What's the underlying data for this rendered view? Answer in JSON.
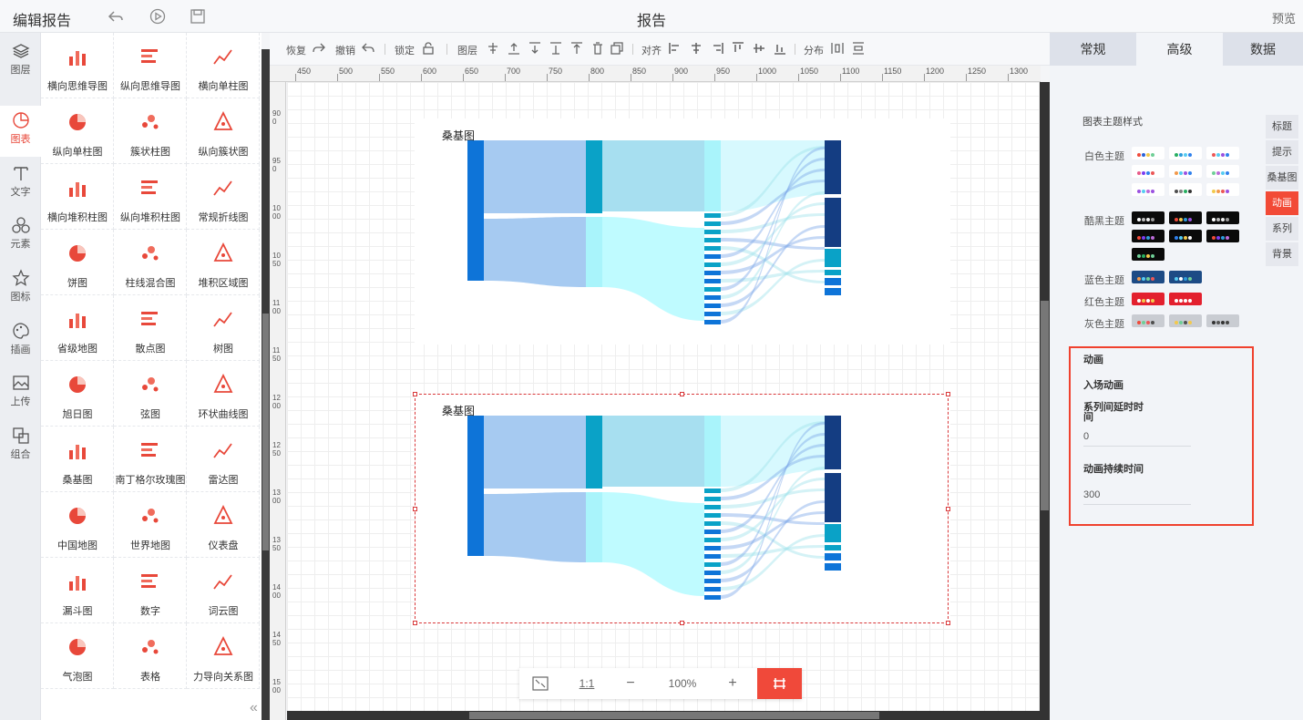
{
  "topbar": {
    "app_title": "编辑报告",
    "doc_title": "报告",
    "preview_label": "预览",
    "icons": [
      "undo-icon",
      "play-icon",
      "save-icon"
    ]
  },
  "leftnav": [
    {
      "label": "图层",
      "icon": "layers-icon"
    },
    {
      "label": "图表",
      "icon": "chart-icon",
      "active": true
    },
    {
      "label": "文字",
      "icon": "text-icon"
    },
    {
      "label": "元素",
      "icon": "shapes-icon"
    },
    {
      "label": "图标",
      "icon": "star-icon"
    },
    {
      "label": "插画",
      "icon": "palette-icon"
    },
    {
      "label": "上传",
      "icon": "upload-image-icon"
    },
    {
      "label": "组合",
      "icon": "group-icon"
    }
  ],
  "palette": [
    "横向思维导图",
    "纵向思维导图",
    "横向单柱图",
    "纵向单柱图",
    "簇状柱图",
    "纵向簇状图",
    "横向堆积柱图",
    "纵向堆积柱图",
    "常规折线图",
    "饼图",
    "柱线混合图",
    "堆积区域图",
    "省级地图",
    "散点图",
    "树图",
    "旭日图",
    "弦图",
    "环状曲线图",
    "桑基图",
    "南丁格尔玫瑰图",
    "雷达图",
    "中国地图",
    "世界地图",
    "仪表盘",
    "漏斗图",
    "数字",
    "词云图",
    "气泡图",
    "表格",
    "力导向关系图"
  ],
  "toolbar": {
    "redo": "恢复",
    "undo": "撤销",
    "lock": "锁定",
    "layer": "图层",
    "align": "对齐",
    "distribute": "分布"
  },
  "ruler": {
    "top": [
      "450",
      "500",
      "550",
      "600",
      "650",
      "700",
      "750",
      "800",
      "850",
      "900",
      "950",
      "1000",
      "1050",
      "1100",
      "1150",
      "1200",
      "1250",
      "1300"
    ],
    "left": [
      "900",
      "950",
      "1000",
      "1050",
      "1100",
      "1150",
      "1200",
      "1250",
      "1300",
      "1350",
      "1400",
      "1450",
      "1500"
    ]
  },
  "canvas": {
    "charts": [
      {
        "title": "桑基图"
      },
      {
        "title": "桑基图"
      }
    ]
  },
  "zoombar": {
    "fit_icon": "fit-screen-icon",
    "ratio": "1:1",
    "minus": "−",
    "zoom": "100%",
    "plus": "+",
    "grid_icon": "grid-icon"
  },
  "rightpanel": {
    "tabs": [
      "常规",
      "高级",
      "数据"
    ],
    "active_tab": "高级",
    "theme_title": "图表主题样式",
    "themes": [
      {
        "label": "白色主题",
        "rows": 3
      },
      {
        "label": "酷黑主题",
        "rows": 3
      },
      {
        "label": "蓝色主题",
        "rows": 1
      },
      {
        "label": "红色主题",
        "rows": 1
      },
      {
        "label": "灰色主题",
        "rows": 1
      }
    ],
    "side_tabs": [
      "标题",
      "提示",
      "桑基图",
      "动画",
      "系列",
      "背景"
    ],
    "active_side_tab": "动画",
    "animation": {
      "title": "动画",
      "enter": "入场动画",
      "delay_label": "系列间延时时间",
      "delay_value": "0",
      "duration_label": "动画持续时间",
      "duration_value": "300"
    }
  },
  "colors": {
    "accent": "#f0493a",
    "sankey_dark": "#143d82",
    "sankey_blue": "#0e74d8",
    "sankey_cyan": "#0aa2c7",
    "sankey_light": "#a9f4fb"
  }
}
